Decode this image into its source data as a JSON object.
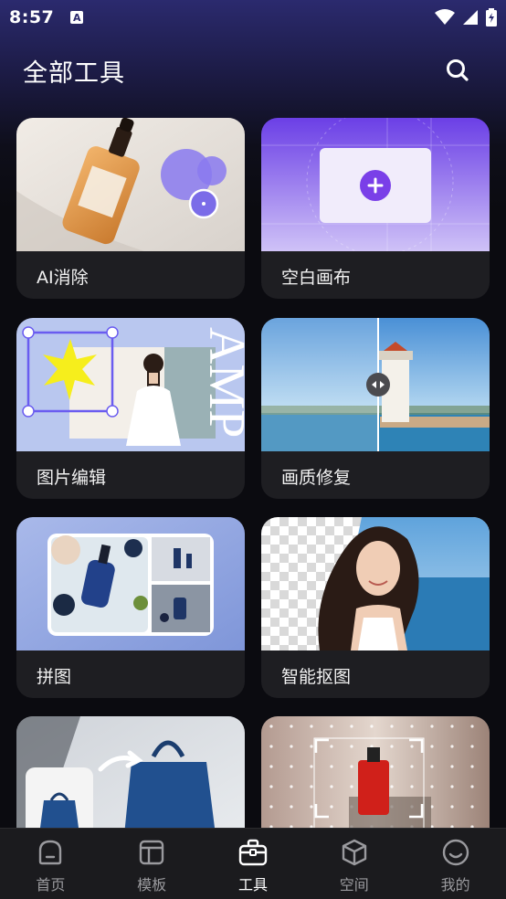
{
  "status_bar": {
    "time": "8:57",
    "notification_letter": "A"
  },
  "header": {
    "title": "全部工具"
  },
  "tools": [
    {
      "label": "AI消除",
      "image": "serum-bottle-photo"
    },
    {
      "label": "空白画布",
      "image": "blank-canvas-add"
    },
    {
      "label": "图片编辑",
      "image": "photo-edit-collage"
    },
    {
      "label": "画质修复",
      "image": "lighthouse-compare"
    },
    {
      "label": "拼图",
      "image": "cosmetics-collage"
    },
    {
      "label": "智能抠图",
      "image": "woman-portrait-cutout"
    },
    {
      "label": "",
      "image": "handbag-product"
    },
    {
      "label": "",
      "image": "red-perfume-crop"
    }
  ],
  "edit_card_text": "AMP",
  "bottom_nav": {
    "items": [
      {
        "label": "首页",
        "icon": "home-icon"
      },
      {
        "label": "模板",
        "icon": "template-icon"
      },
      {
        "label": "工具",
        "icon": "toolbox-icon"
      },
      {
        "label": "空间",
        "icon": "cube-icon"
      },
      {
        "label": "我的",
        "icon": "smile-icon"
      }
    ],
    "active_index": 2
  },
  "colors": {
    "accent": "#7a4cf0",
    "nav_bg": "#1b1b1e",
    "card_bg": "#1e1e22"
  }
}
